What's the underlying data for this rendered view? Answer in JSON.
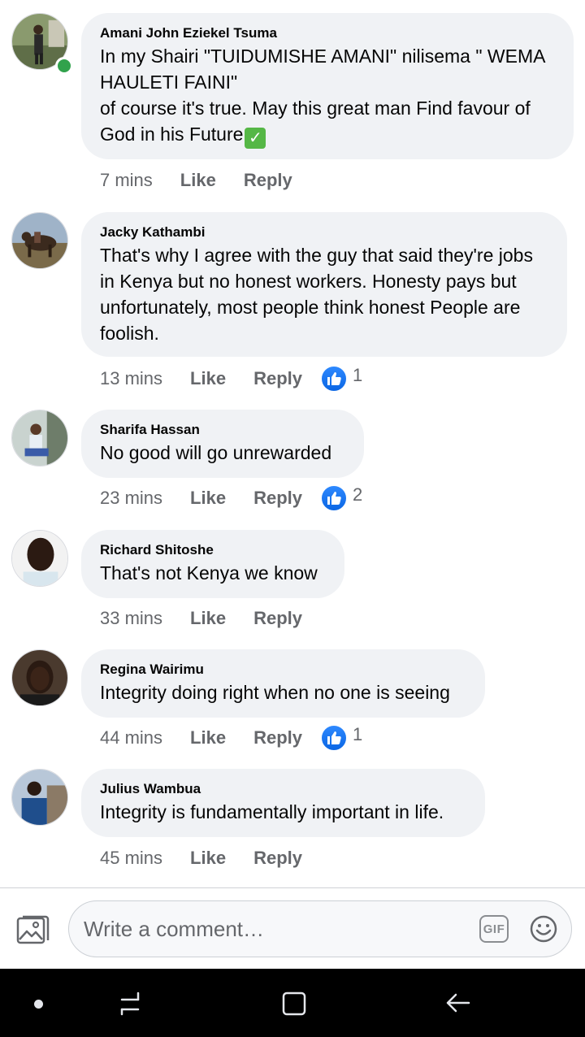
{
  "comments": [
    {
      "author": "Amani John Eziekel Tsuma",
      "text": "In my Shairi \"TUIDUMISHE AMANI\" nilisema \" WEMA HAULETI FAINI\"\nof course it's true. May this great man Find favour of God in his Future",
      "time": "7 mins",
      "like": "Like",
      "reply": "Reply",
      "reactions": "",
      "online": true
    },
    {
      "author": "Jacky Kathambi",
      "text": "That's why I agree with the guy that said they're jobs in Kenya but no honest workers. Honesty pays but unfortunately,  most people think honest People are foolish.",
      "time": "13 mins",
      "like": "Like",
      "reply": "Reply",
      "reactions": "1"
    },
    {
      "author": "Sharifa Hassan",
      "text": "No good will go unrewarded",
      "time": "23 mins",
      "like": "Like",
      "reply": "Reply",
      "reactions": "2"
    },
    {
      "author": "Richard Shitoshe",
      "text": "That's not Kenya we know",
      "time": "33 mins",
      "like": "Like",
      "reply": "Reply",
      "reactions": ""
    },
    {
      "author": "Regina Wairimu",
      "text": "Integrity doing right when no one is seeing",
      "time": "44 mins",
      "like": "Like",
      "reply": "Reply",
      "reactions": "1"
    },
    {
      "author": "Julius Wambua",
      "text": "Integrity is fundamentally important in life.",
      "time": "45 mins",
      "like": "Like",
      "reply": "Reply",
      "reactions": ""
    }
  ],
  "composer": {
    "placeholder": "Write a comment…",
    "gif_label": "GIF",
    "photo_icon": "photo-icon",
    "emoji_icon": "emoji-icon"
  },
  "colors": {
    "bubble": "#f0f2f5",
    "meta_text": "#65676b",
    "like_blue": "#1877f2",
    "online_green": "#31a24c",
    "check_green": "#55b746"
  }
}
